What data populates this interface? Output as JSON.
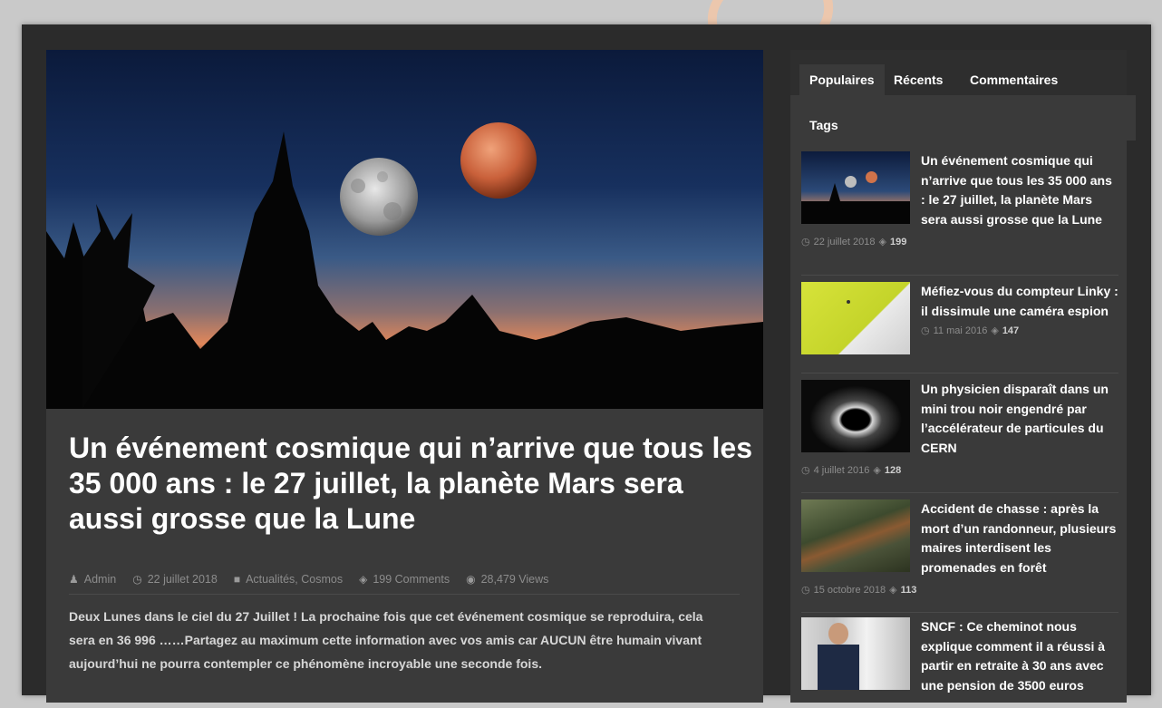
{
  "article": {
    "title": "Un événement cosmique qui n’arrive que tous les 35 000 ans : le 27 juillet, la planète Mars sera aussi grosse que la Lune",
    "author": "Admin",
    "date": "22 juillet 2018",
    "categories": "Actualités, Cosmos",
    "comments": "199 Comments",
    "views": "28,479 Views",
    "excerpt": "Deux Lunes dans le ciel du 27 Juillet ! La prochaine fois que cet événement cosmique se reproduira, cela sera en 36 996 ……Partagez au maximum cette information avec vos amis car AUCUN être humain vivant aujourd’hui ne pourra contempler ce phénomène incroyable une seconde fois."
  },
  "sidebar": {
    "tabs": [
      "Populaires",
      "Récents",
      "Commentaires",
      "Tags"
    ],
    "posts": [
      {
        "title": "Un événement cosmique qui n’arrive que tous les 35 000 ans : le 27 juillet, la planète Mars sera aussi grosse que la Lune",
        "date": "22 juillet 2018",
        "comments": "199",
        "thumb": "night-sky-moon-mars"
      },
      {
        "title": "Méfiez-vous du compteur Linky : il dissimule une caméra espion",
        "date": "11 mai 2016",
        "comments": "147",
        "thumb": "linky-meter"
      },
      {
        "title": "Un physicien disparaît dans un mini trou noir engendré par l’accélérateur de particules du CERN",
        "date": "4 juillet 2016",
        "comments": "128",
        "thumb": "black-hole"
      },
      {
        "title": "Accident de chasse : après la mort d’un randonneur, plusieurs maires interdisent les promenades en forêt",
        "date": "15 octobre 2018",
        "comments": "113",
        "thumb": "hunter-rifle"
      },
      {
        "title": "SNCF : Ce cheminot nous explique comment il a réussi à partir en retraite à 30 ans avec une pension de 3500 euros",
        "date": "",
        "comments": "",
        "thumb": "man-in-suit"
      }
    ]
  },
  "colors": {
    "page_bg": "#c9c9c9",
    "frame_bg": "#2b2b2b",
    "panel_bg": "#3a3a3a",
    "text": "#ffffff",
    "muted": "#8c8c8c"
  }
}
